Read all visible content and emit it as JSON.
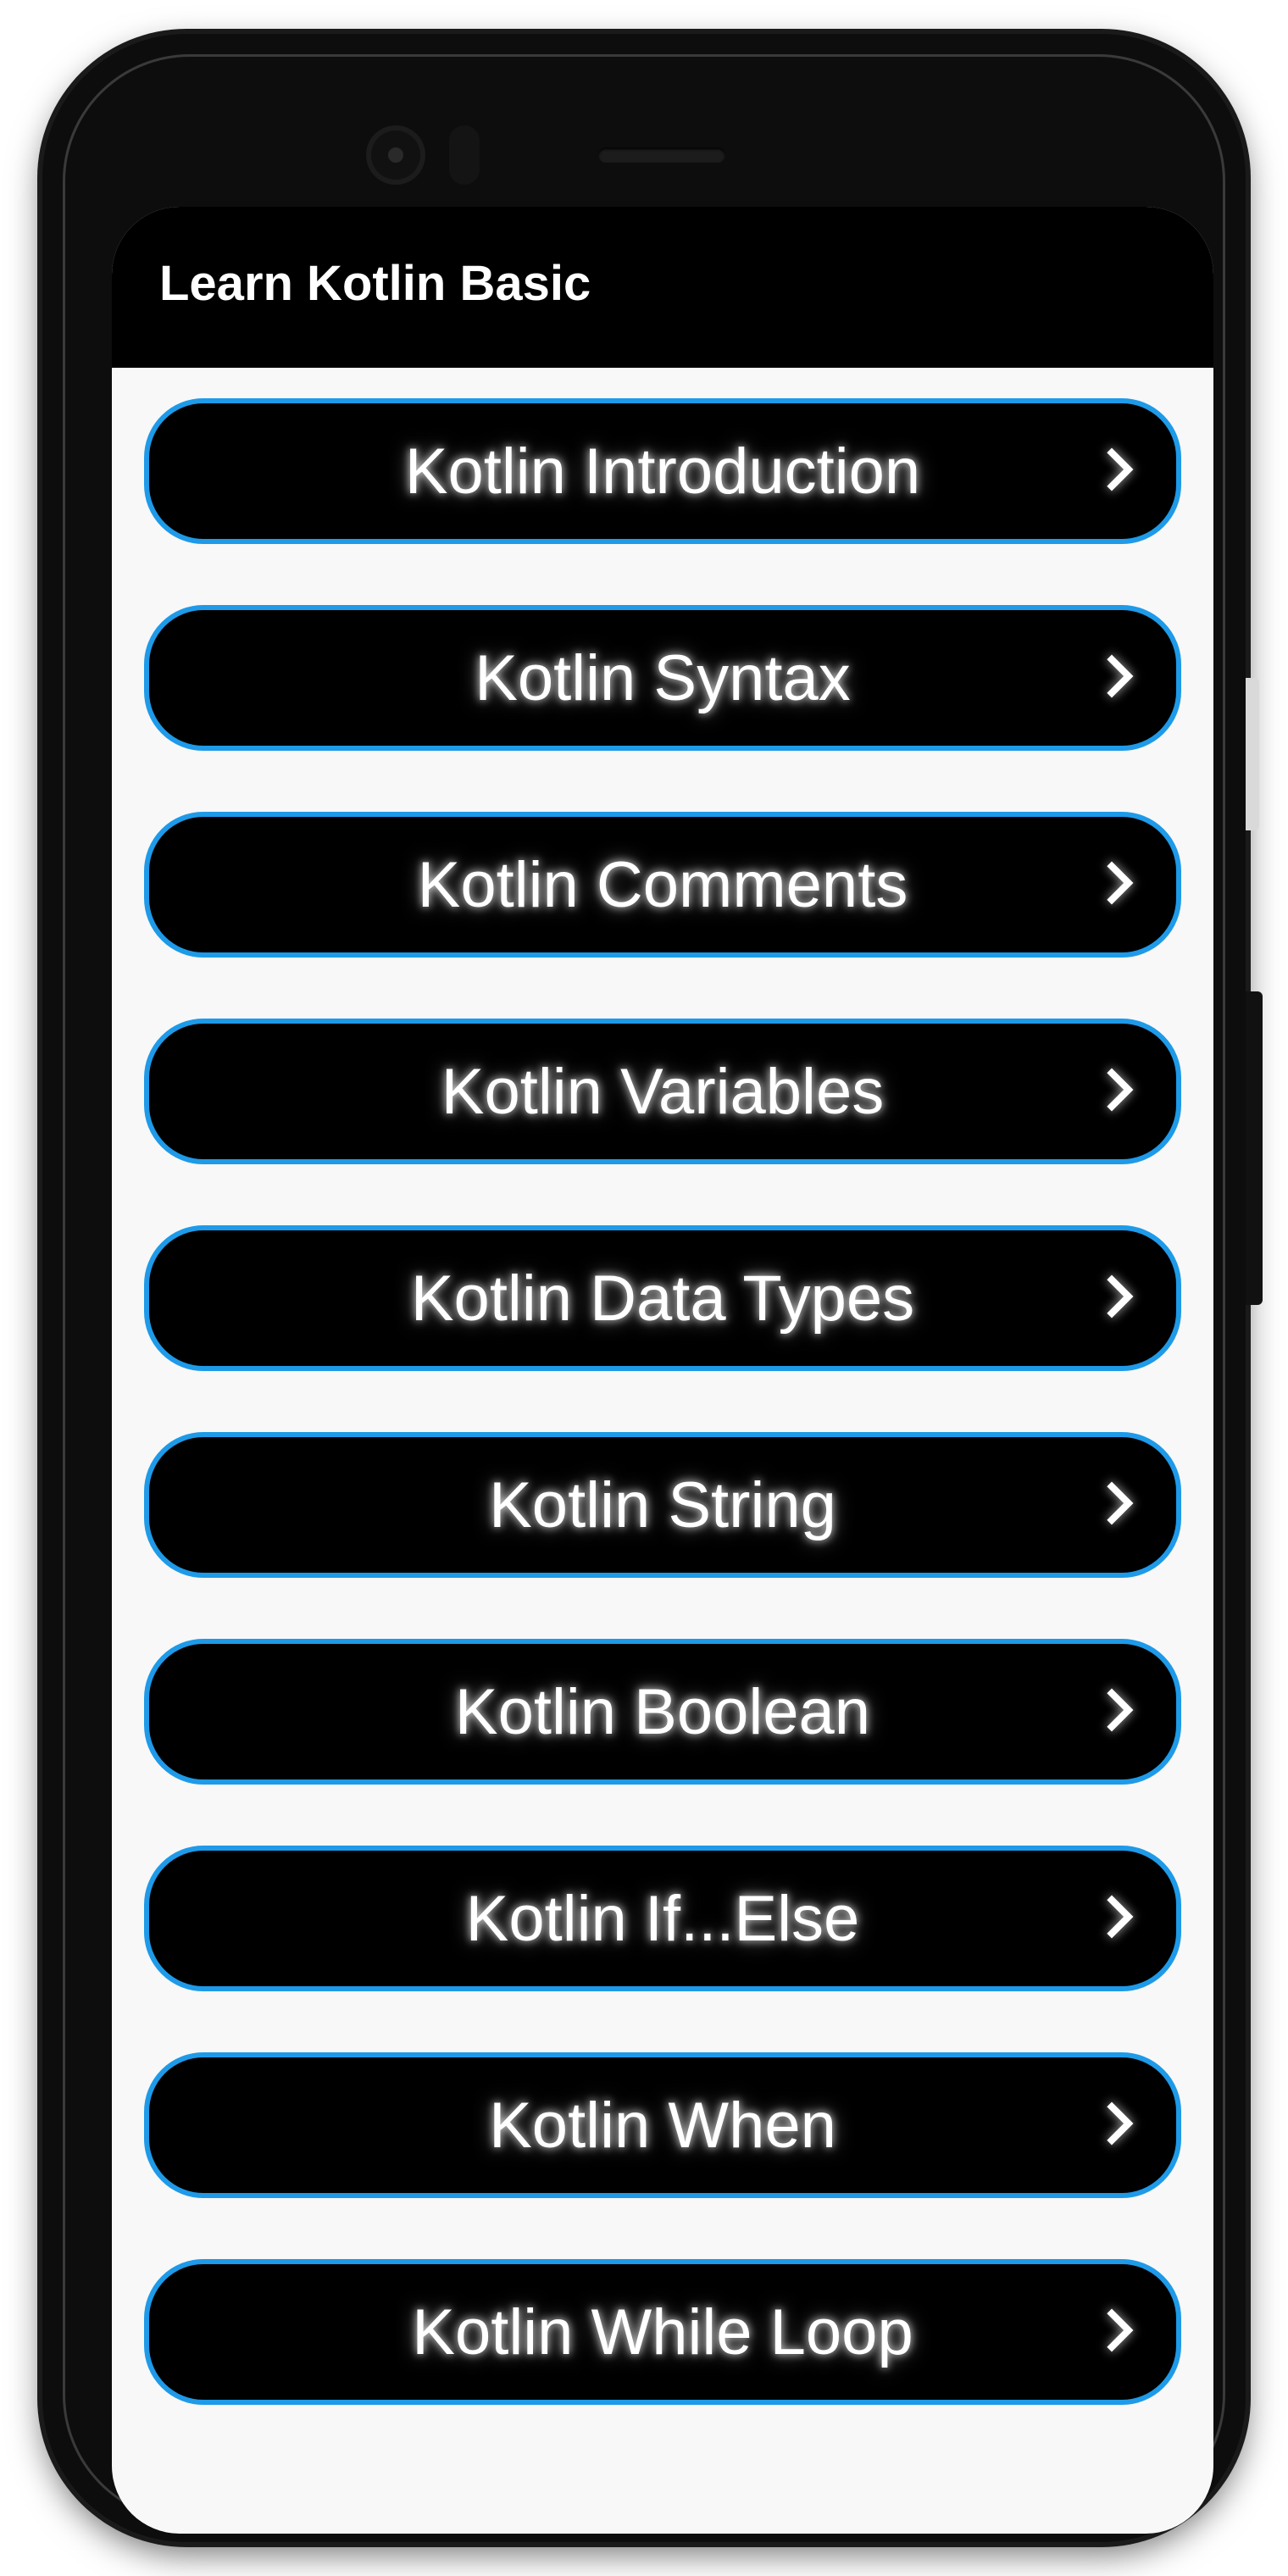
{
  "app_bar": {
    "title": "Learn Kotlin Basic"
  },
  "topics": [
    {
      "label": "Kotlin Introduction"
    },
    {
      "label": "Kotlin Syntax"
    },
    {
      "label": "Kotlin Comments"
    },
    {
      "label": "Kotlin Variables"
    },
    {
      "label": "Kotlin Data Types"
    },
    {
      "label": "Kotlin String"
    },
    {
      "label": "Kotlin Boolean"
    },
    {
      "label": "Kotlin If...Else"
    },
    {
      "label": "Kotlin When"
    },
    {
      "label": "Kotlin While Loop"
    }
  ],
  "icons": {
    "item_arrow": "chevron-right-icon"
  },
  "colors": {
    "app_bar_bg": "#000000",
    "screen_bg": "#f8f8f8",
    "item_bg": "#000000",
    "item_border": "#1e9ae8",
    "item_text": "#ffffff"
  }
}
